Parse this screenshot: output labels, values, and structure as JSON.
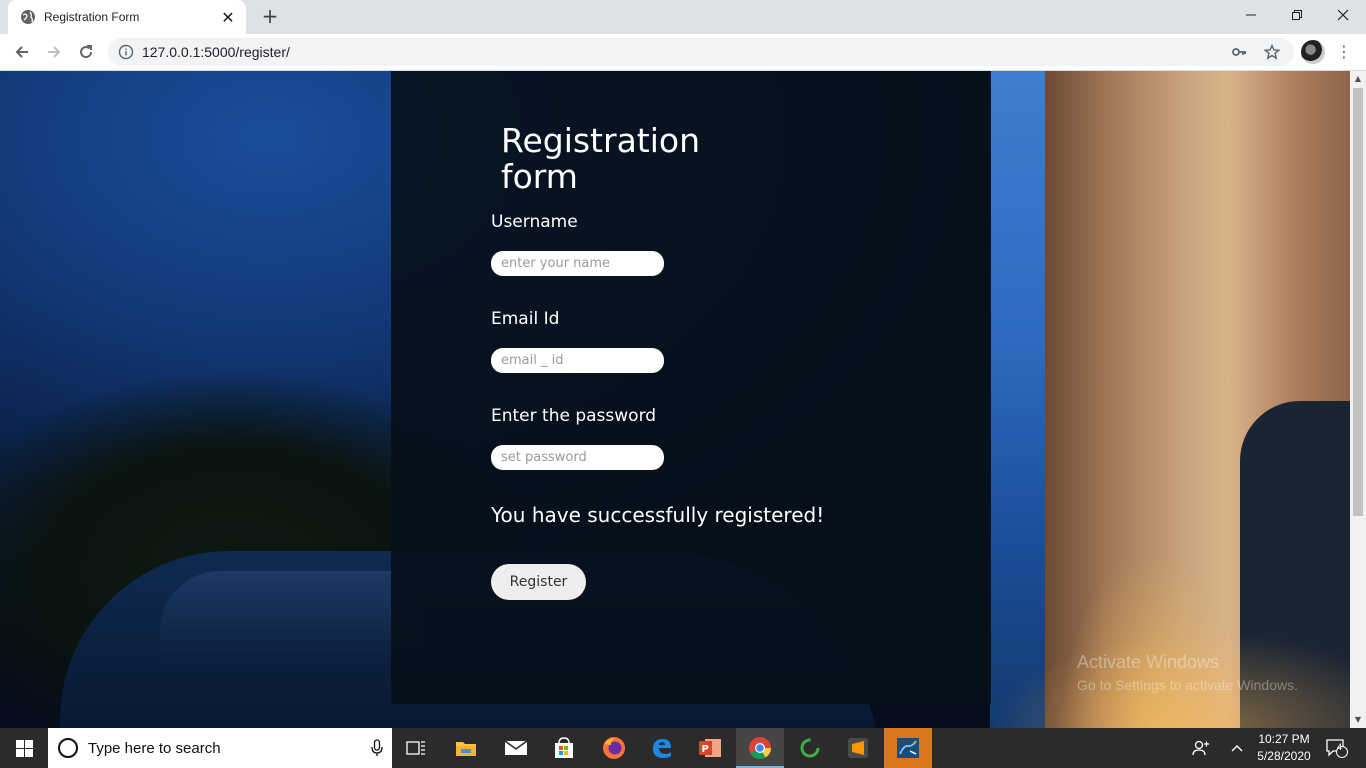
{
  "browser": {
    "tab_title": "Registration Form",
    "tab_close": "✕",
    "new_tab": "+",
    "url": "127.0.0.1:5000/register/",
    "window_minimize": "—",
    "window_restore": "❐",
    "window_close": "✕",
    "menu": "⋮"
  },
  "form": {
    "title": "Registration form",
    "username_label": "Username",
    "username_placeholder": "enter your name",
    "email_label": "Email Id",
    "email_placeholder": "email _ id",
    "password_label": "Enter the password",
    "password_placeholder": "set password",
    "success_message": "You have successfully registered!",
    "register_label": "Register"
  },
  "watermark": {
    "line1": "Activate Windows",
    "line2": "Go to Settings to activate Windows."
  },
  "taskbar": {
    "search_placeholder": "Type here to search",
    "time": "10:27 PM",
    "date": "5/28/2020",
    "notification_count": "4",
    "apps": [
      "task-view",
      "file-explorer",
      "mail",
      "store",
      "firefox",
      "edge",
      "powerpoint",
      "chrome",
      "spinner-app",
      "sublime-text",
      "mysql-workbench"
    ]
  },
  "colors": {
    "panel": "#06101a",
    "taskbar": "#2b2b2b",
    "highlight": "#d9761e"
  }
}
